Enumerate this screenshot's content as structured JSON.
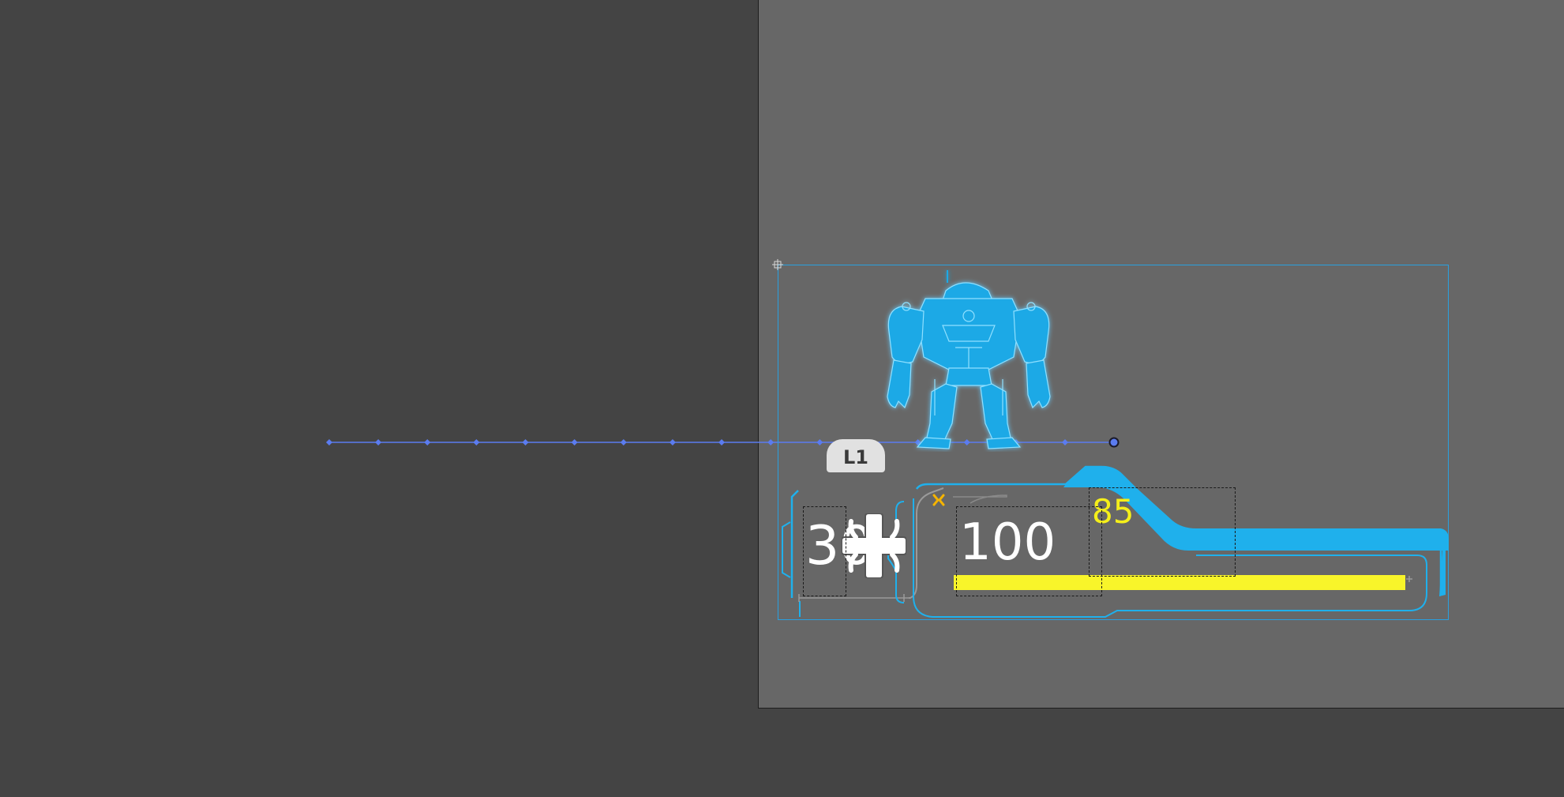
{
  "editor": {
    "timeline_badge": "L1",
    "keyframe_count": 16,
    "selection_color": "#29a0e0",
    "keyframe_color": "#5b7cf0"
  },
  "hud": {
    "health_small": "30",
    "health_main": "100",
    "armor_value": "85",
    "health_bar_fraction": 1.0,
    "accent_color": "#1fb0ec",
    "bar_color": "#f8f52a",
    "armor_color": "#f5ef1a",
    "character_icon": "mech-robot-icon",
    "medkit_icon": "medical-cross-icon",
    "armor_icon": "armor-tick-icon"
  }
}
